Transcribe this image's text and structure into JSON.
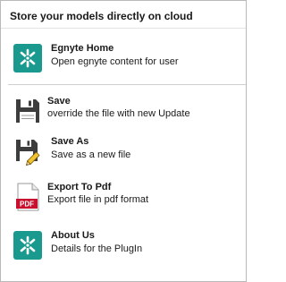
{
  "panel": {
    "header": "Store your models directly on cloud"
  },
  "items": [
    {
      "title": "Egnyte Home",
      "description": "Open egnyte content for user",
      "icon": "egnyte-logo-icon"
    },
    {
      "title": "Save",
      "description": "override the file with new Update",
      "icon": "floppy-disk-icon"
    },
    {
      "title": "Save As",
      "description": "Save as a new file",
      "icon": "floppy-disk-pencil-icon"
    },
    {
      "title": "Export To Pdf",
      "description": "Export file in pdf format",
      "icon": "pdf-file-icon",
      "icon_badge": "PDF"
    },
    {
      "title": "About Us",
      "description": "Details for the PlugIn",
      "icon": "egnyte-logo-icon"
    }
  ],
  "colors": {
    "egnyte_teal": "#1a9a8f",
    "floppy_dark": "#3d3d3d",
    "pdf_red": "#c8102e",
    "pencil_yellow": "#f2c232"
  }
}
